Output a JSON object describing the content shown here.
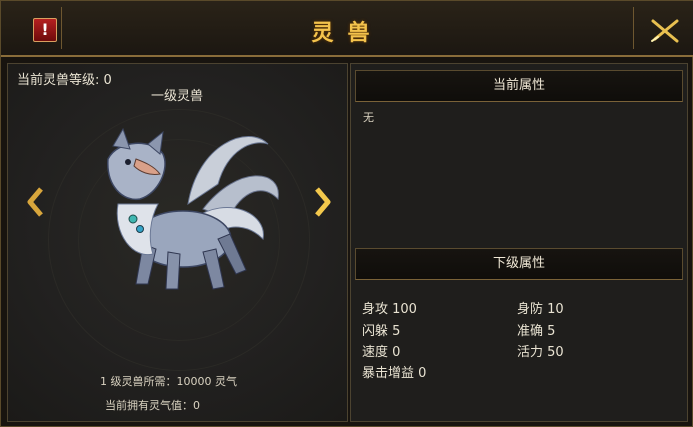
{
  "window": {
    "title": "灵兽"
  },
  "left": {
    "current_level": "当前灵兽等级: 0",
    "beast_name": "一级灵兽",
    "requirement": "1 级灵兽所需：10000 灵气",
    "owned": "当前拥有灵气值：0"
  },
  "right": {
    "current_header": "当前属性",
    "current_value": "无",
    "next_header": "下级属性",
    "attributes": [
      {
        "label": "身攻 100"
      },
      {
        "label": "身防 10"
      },
      {
        "label": "闪躲 5"
      },
      {
        "label": "准确 5"
      },
      {
        "label": "速度 0"
      },
      {
        "label": "活力 50"
      },
      {
        "label": "暴击增益 0"
      }
    ]
  },
  "colors": {
    "title": "#f3c24c",
    "border": "#8a6d3a",
    "text": "#e9e3d2"
  },
  "icons": {
    "alert": "exclamation-icon",
    "close": "close-icon",
    "prev": "arrow-left-icon",
    "next": "arrow-right-icon"
  }
}
